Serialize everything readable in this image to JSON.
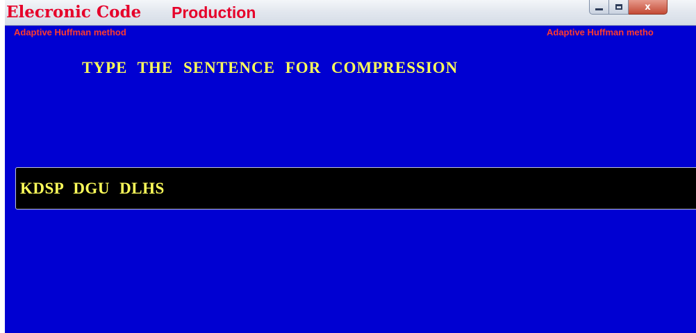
{
  "window": {
    "title_part1": "Elecronic Code",
    "title_part2": "Production",
    "controls": {
      "minimize_icon": "minimize-icon",
      "maximize_icon": "maximize-icon",
      "close_icon": "close-icon",
      "close_glyph": "x"
    }
  },
  "subtitle": {
    "left": "Adaptive Huffman method",
    "right": "Adaptive Huffman metho"
  },
  "main": {
    "heading": "TYPE THE SENTENCE FOR COMPRESSION",
    "input_value": "KDSP DGU DLHS"
  },
  "colors": {
    "background": "#0000d2",
    "text_yellow": "#ffff5a",
    "title_red": "#e6002a",
    "subtitle_red": "#ff3b2f",
    "input_bg": "#000000"
  }
}
